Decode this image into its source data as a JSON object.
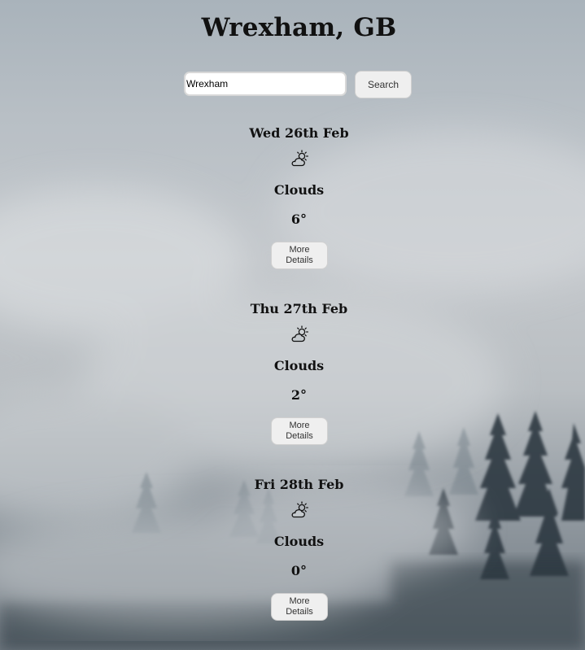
{
  "header": {
    "title": "Wrexham, GB"
  },
  "search": {
    "value": "Wrexham",
    "button_label": "Search"
  },
  "forecast": [
    {
      "date": "Wed 26th Feb",
      "icon": "partly-cloudy-icon",
      "condition": "Clouds",
      "temperature": "6°",
      "button_label": "More Details"
    },
    {
      "date": "Thu 27th Feb",
      "icon": "partly-cloudy-icon",
      "condition": "Clouds",
      "temperature": "2°",
      "button_label": "More Details"
    },
    {
      "date": "Fri 28th Feb",
      "icon": "partly-cloudy-icon",
      "condition": "Clouds",
      "temperature": "0°",
      "button_label": "More Details"
    }
  ],
  "background": {
    "scene": "misty-forest",
    "colors": {
      "sky": "#b9c0c6",
      "mist": "#d4d7da",
      "trees": "#1f2b33"
    }
  }
}
